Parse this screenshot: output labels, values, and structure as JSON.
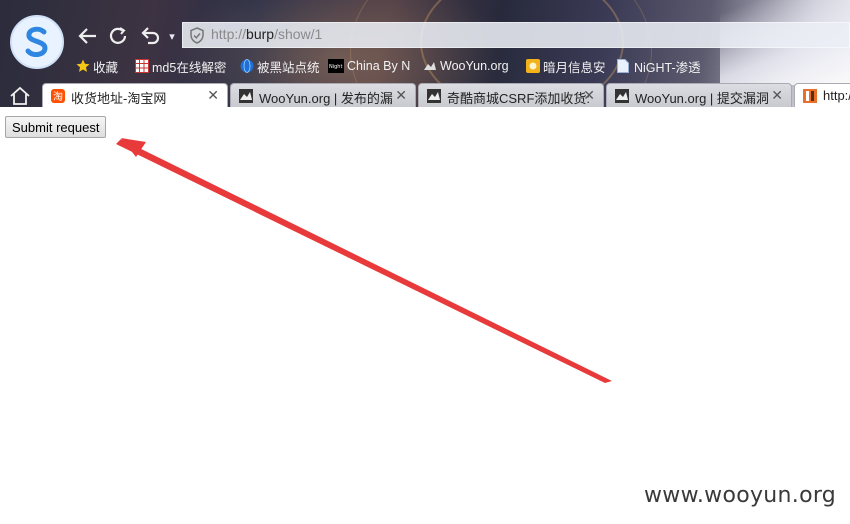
{
  "browser": {
    "address_bar": {
      "url_prefix": "http://",
      "url_host": "burp",
      "url_path": "/show/1"
    },
    "nav_icons": [
      "back-icon",
      "refresh-icon",
      "undo-icon"
    ],
    "bookmarks": [
      {
        "label": "收藏",
        "icon": "star-icon",
        "color": "#f5c518"
      },
      {
        "label": "md5在线解密",
        "icon": "grid-icon",
        "color": "#e84040"
      },
      {
        "label": "被黑站点统",
        "icon": "globe-icon",
        "color": "#1e6fd6"
      },
      {
        "label": "China By N",
        "icon": "night-icon",
        "color": "#000000"
      },
      {
        "label": "WooYun.org",
        "icon": "wooyun-icon",
        "color": "#666666"
      },
      {
        "label": "暗月信息安",
        "icon": "moon-icon",
        "color": "#f2b21a"
      },
      {
        "label": "NiGHT-渗透",
        "icon": "page-icon",
        "color": "#a8c4e8"
      }
    ],
    "tabs": [
      {
        "title": "收货地址-淘宝网",
        "icon": "taobao-icon",
        "color": "#ff5000"
      },
      {
        "title": "WooYun.org | 发布的漏",
        "icon": "wooyun-icon",
        "color": "#444444"
      },
      {
        "title": "奇酷商城CSRF添加收货:",
        "icon": "wooyun-icon",
        "color": "#444444"
      },
      {
        "title": "WooYun.org | 提交漏洞",
        "icon": "wooyun-icon",
        "color": "#444444"
      },
      {
        "title": "http:/",
        "icon": "burp-icon",
        "color": "#e8702a"
      }
    ]
  },
  "page": {
    "submit_label": "Submit request"
  },
  "annotation": {
    "arrow_color": "#e83a3a"
  },
  "watermark": "www.wooyun.org"
}
